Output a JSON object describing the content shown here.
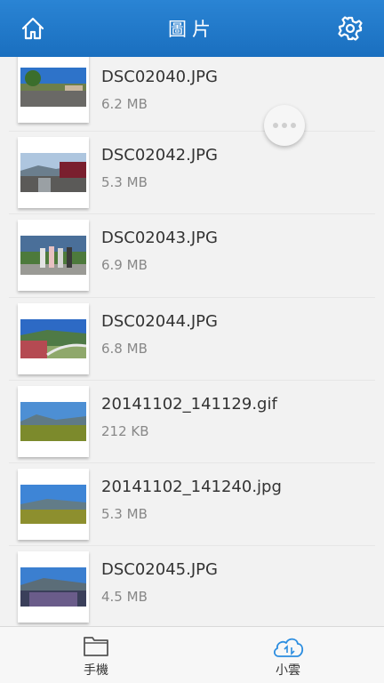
{
  "header": {
    "title": "圖片",
    "home_icon": "home-icon",
    "settings_icon": "gear-icon"
  },
  "files": [
    {
      "name": "DSC02040.JPG",
      "size": "6.2 MB"
    },
    {
      "name": "DSC02042.JPG",
      "size": "5.3 MB"
    },
    {
      "name": "DSC02043.JPG",
      "size": "6.9 MB"
    },
    {
      "name": "DSC02044.JPG",
      "size": "6.8 MB"
    },
    {
      "name": "20141102_141129.gif",
      "size": "212 KB"
    },
    {
      "name": "20141102_141240.jpg",
      "size": "5.3 MB"
    },
    {
      "name": "DSC02045.JPG",
      "size": "4.5 MB"
    }
  ],
  "tabs": [
    {
      "label": "手機",
      "icon": "folder-icon"
    },
    {
      "label": "小雲",
      "icon": "cloud-sync-icon",
      "active": true
    }
  ],
  "colors": {
    "header": "#1f78c8",
    "accent": "#2b8de0"
  }
}
